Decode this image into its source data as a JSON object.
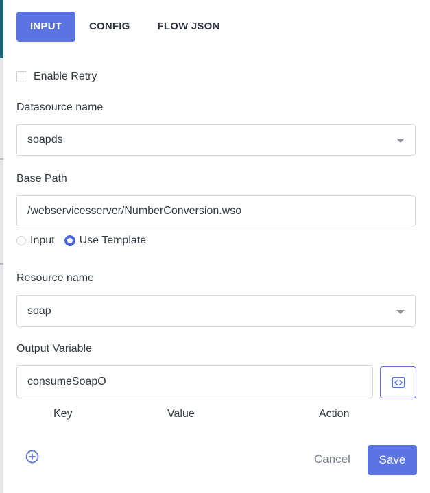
{
  "tabs": [
    {
      "label": "INPUT",
      "active": true
    },
    {
      "label": "CONFIG",
      "active": false
    },
    {
      "label": "FLOW JSON",
      "active": false
    }
  ],
  "enable_retry": {
    "label": "Enable Retry",
    "checked": false
  },
  "datasource": {
    "label": "Datasource name",
    "value": "soapds"
  },
  "base_path": {
    "label": "Base Path",
    "value": "/webservicesserver/NumberConversion.wso",
    "options": [
      {
        "label": "Input",
        "selected": false
      },
      {
        "label": "Use Template",
        "selected": true
      }
    ]
  },
  "resource": {
    "label": "Resource name",
    "value": "soap"
  },
  "output_variable": {
    "label": "Output Variable",
    "value": "consumeSoapO",
    "code_icon": "code-brackets-icon"
  },
  "table": {
    "columns": [
      "Key",
      "Value",
      "Action"
    ],
    "add_icon": "plus-circle-icon"
  },
  "actions": {
    "cancel": "Cancel",
    "save": "Save"
  },
  "colors": {
    "accent": "#5a74e2",
    "radio": "#4b66dd",
    "border": "#d5d8dd",
    "text": "#343b46"
  }
}
